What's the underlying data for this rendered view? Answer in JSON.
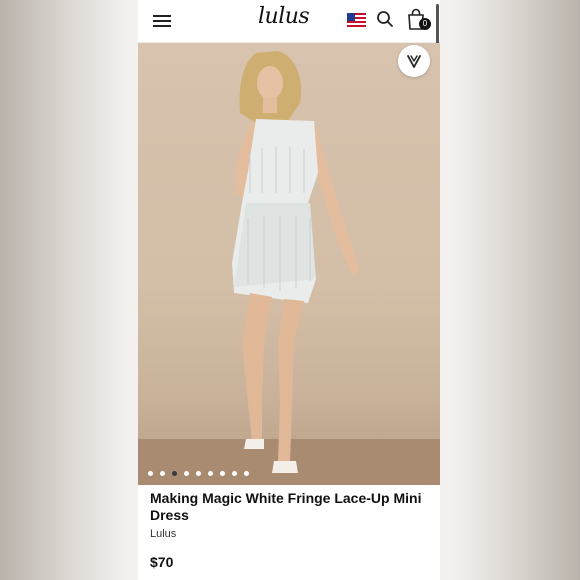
{
  "header": {
    "logo_text": "lulus",
    "cart_count": "0",
    "icons": [
      "hamburger-menu-icon",
      "us-flag-icon",
      "search-icon",
      "shopping-bag-icon"
    ]
  },
  "gallery": {
    "dot_count": 9,
    "active_index": 2,
    "favorite_icon": "heart-icon"
  },
  "product": {
    "title": "Making Magic White Fringe Lace-Up Mini Dress",
    "brand": "Lulus",
    "price": "$70"
  },
  "colors": {
    "backdrop": "#d3bea7",
    "floor": "#a98b71",
    "text": "#111111"
  }
}
